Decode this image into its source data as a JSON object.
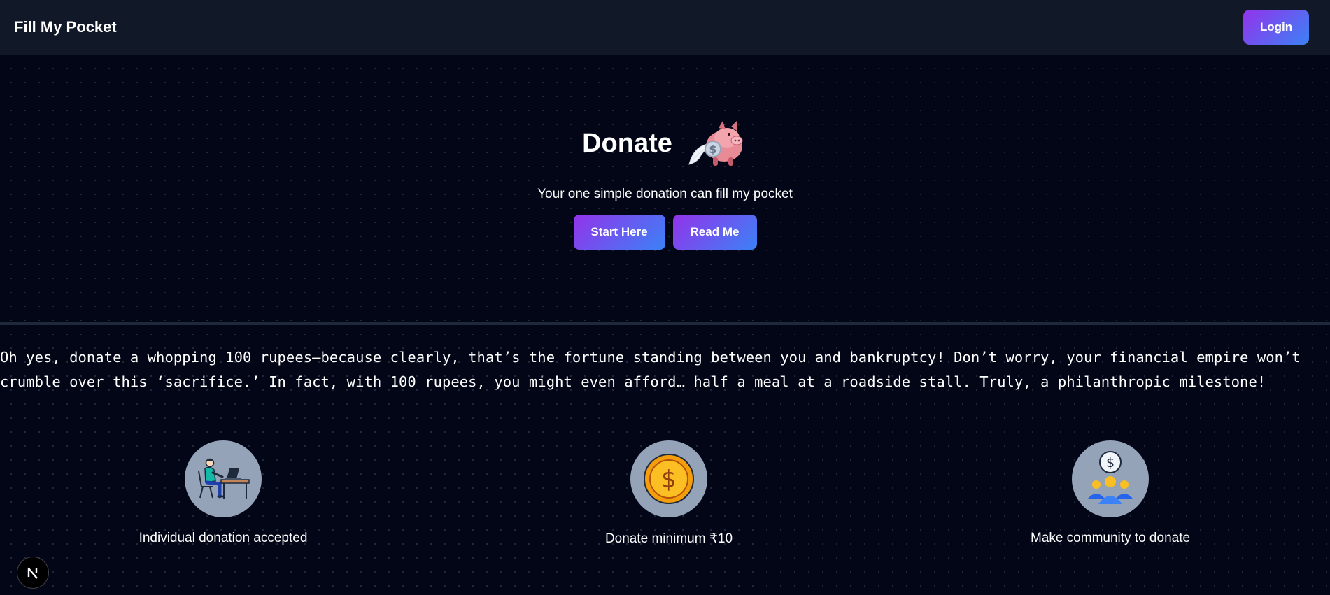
{
  "navbar": {
    "brand": "Fill My Pocket",
    "login_label": "Login"
  },
  "hero": {
    "title": "Donate",
    "subtitle": "Your one simple donation can fill my pocket",
    "start_label": "Start Here",
    "read_label": "Read Me",
    "icon": "flying-piggy-bank-icon"
  },
  "sarcasm_text": "Oh yes, donate a whopping 100 rupees—because clearly, that’s the fortune standing between you and bankruptcy! Don’t worry, your financial empire won’t crumble over this ‘sacrifice.’ In fact, with 100 rupees, you might even afford… half a meal at a roadside stall. Truly, a philanthropic milestone!",
  "features": [
    {
      "label": "Individual donation accepted",
      "icon": "person-at-desk-icon"
    },
    {
      "label": "Donate minimum ₹10",
      "icon": "gold-coin-icon"
    },
    {
      "label": "Make community to donate",
      "icon": "community-donation-icon"
    }
  ],
  "badge": {
    "letter": "N",
    "icon": "nextjs-dev-badge-icon"
  },
  "colors": {
    "background": "#020617",
    "navbar": "#111827",
    "gradient_start": "#9333ea",
    "gradient_end": "#3b82f6",
    "feature_circle": "#94a3b8"
  }
}
